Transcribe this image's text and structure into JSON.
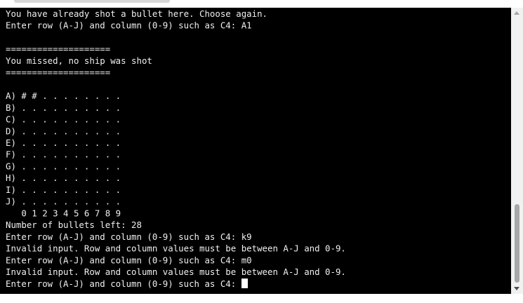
{
  "terminal": {
    "lines": [
      "You have already shot a bullet here. Choose again.",
      "Enter row (A-J) and column (0-9) such as C4: A1",
      "",
      "====================",
      "You missed, no ship was shot",
      "====================",
      "",
      "A) # # . . . . . . . .",
      "B) . . . . . . . . . .",
      "C) . . . . . . . . . .",
      "D) . . . . . . . . . .",
      "E) . . . . . . . . . .",
      "F) . . . . . . . . . .",
      "G) . . . . . . . . . .",
      "H) . . . . . . . . . .",
      "I) . . . . . . . . . .",
      "J) . . . . . . . . . .",
      "   0 1 2 3 4 5 6 7 8 9",
      "Number of bullets left: 28",
      "Enter row (A-J) and column (0-9) such as C4: k9",
      "Invalid input. Row and column values must be between A-J and 0-9.",
      "Enter row (A-J) and column (0-9) such as C4: m0",
      "Invalid input. Row and column values must be between A-J and 0-9."
    ],
    "prompt": "Enter row (A-J) and column (0-9) such as C4: "
  },
  "icons": {
    "scroll_up": "scroll-up-arrow-icon",
    "scroll_down": "scroll-down-arrow-icon"
  },
  "colors": {
    "terminal_background": "#000000",
    "terminal_text": "#f0f0f0",
    "cursor": "#ffffff"
  }
}
